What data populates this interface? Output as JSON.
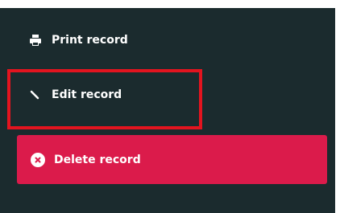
{
  "menu": {
    "print_label": "Print record",
    "edit_label": "Edit record",
    "delete_label": "Delete record"
  },
  "colors": {
    "panel_bg": "#1b2b2e",
    "delete_bg": "#db1b4b",
    "highlight": "#e3141f",
    "text": "#ffffff"
  },
  "icons": {
    "print": "printer-icon",
    "edit": "pencil-icon",
    "delete": "close-circle-icon"
  }
}
